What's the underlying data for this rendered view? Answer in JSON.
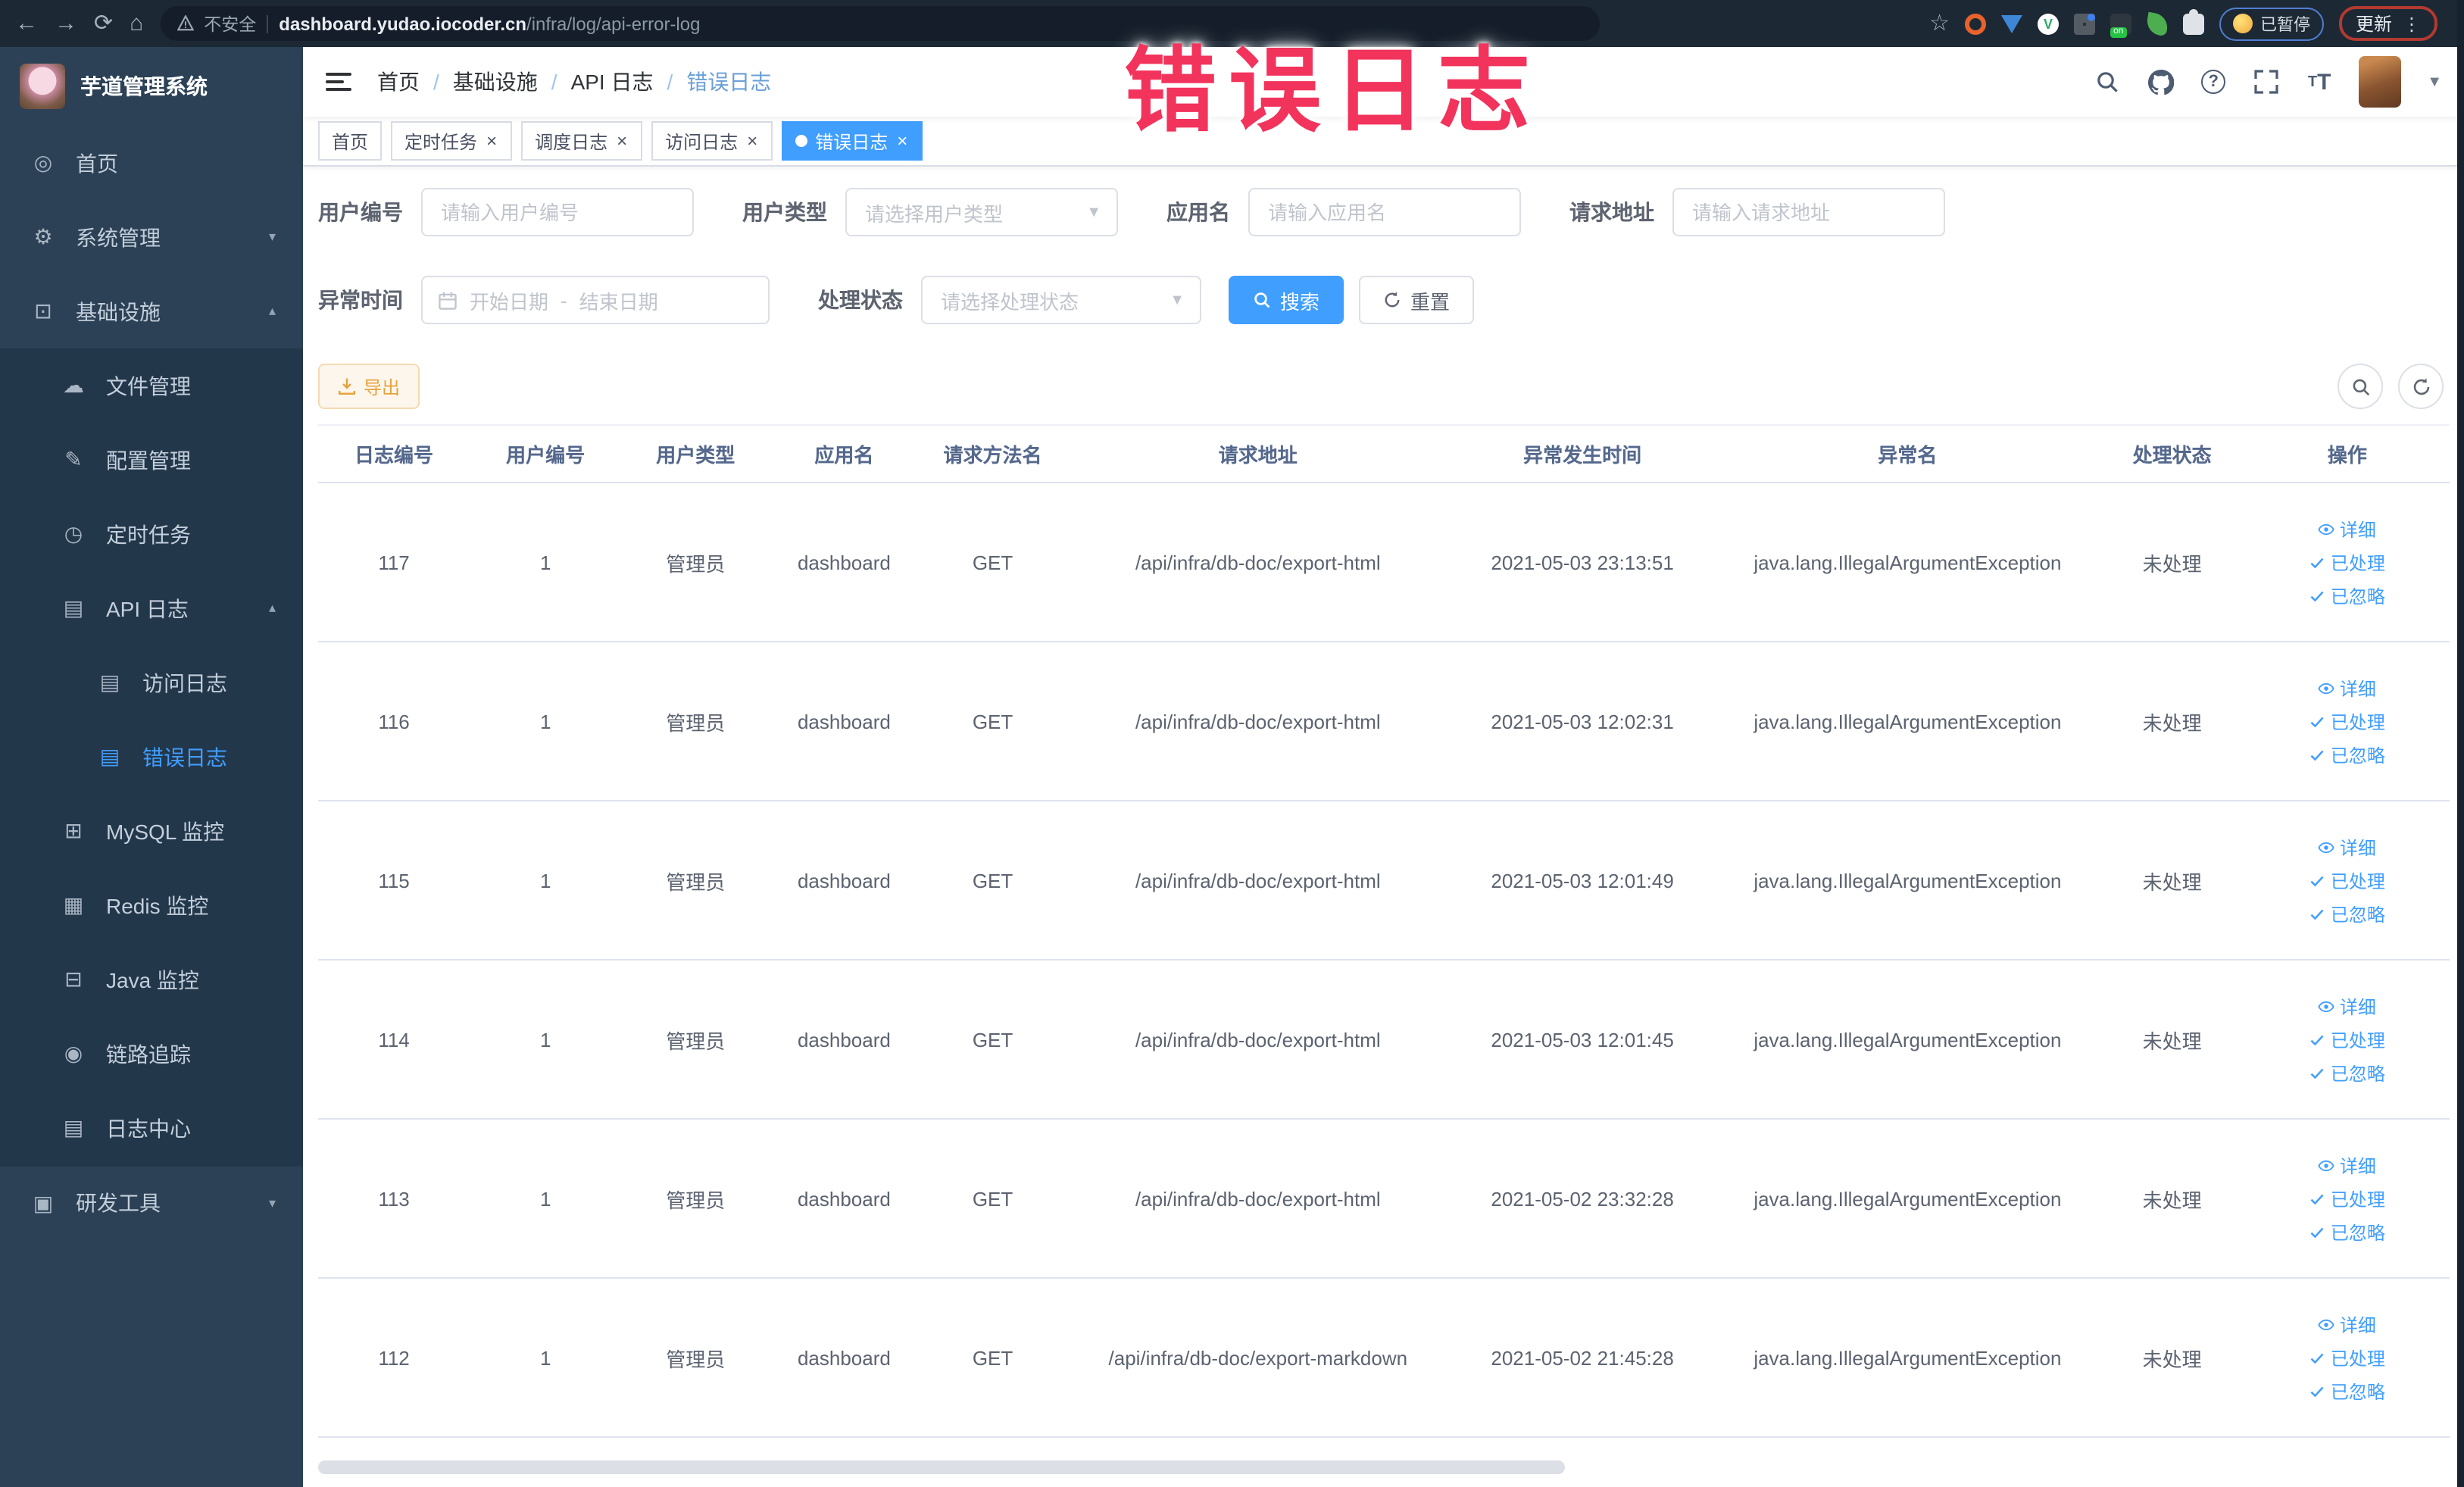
{
  "browser": {
    "security_label": "不安全",
    "url_host": "dashboard.yudao.iocoder.cn",
    "url_path": "/infra/log/api-error-log",
    "paused_label": "已暂停",
    "update_label": "更新"
  },
  "annotation": {
    "text": "错误日志",
    "color": "#f2335c"
  },
  "sidebar": {
    "title": "芋道管理系统",
    "items": [
      {
        "label": "首页",
        "icon": "dashboard",
        "level": 1
      },
      {
        "label": "系统管理",
        "icon": "gear",
        "level": 1,
        "arrow": "down"
      },
      {
        "label": "基础设施",
        "icon": "monitor",
        "level": 1,
        "arrow": "up"
      },
      {
        "label": "文件管理",
        "icon": "cloud",
        "level": 2,
        "dark": true
      },
      {
        "label": "配置管理",
        "icon": "edit",
        "level": 2,
        "dark": true
      },
      {
        "label": "定时任务",
        "icon": "clock",
        "level": 2,
        "dark": true
      },
      {
        "label": "API 日志",
        "icon": "doc",
        "level": 2,
        "dark": true,
        "arrow": "up"
      },
      {
        "label": "访问日志",
        "icon": "doc",
        "level": 3,
        "dark": true
      },
      {
        "label": "错误日志",
        "icon": "doc",
        "level": 3,
        "dark": true,
        "active": true
      },
      {
        "label": "MySQL 监控",
        "icon": "mysql",
        "level": 2,
        "dark": true
      },
      {
        "label": "Redis 监控",
        "icon": "redis",
        "level": 2,
        "dark": true
      },
      {
        "label": "Java 监控",
        "icon": "java",
        "level": 2,
        "dark": true
      },
      {
        "label": "链路追踪",
        "icon": "eye",
        "level": 2,
        "dark": true
      },
      {
        "label": "日志中心",
        "icon": "doc",
        "level": 2,
        "dark": true
      },
      {
        "label": "研发工具",
        "icon": "toolbox",
        "level": 1,
        "arrow": "down",
        "section_top": true
      }
    ]
  },
  "breadcrumb": [
    "首页",
    "基础设施",
    "API 日志",
    "错误日志"
  ],
  "tabs": [
    {
      "label": "首页"
    },
    {
      "label": "定时任务",
      "closable": true
    },
    {
      "label": "调度日志",
      "closable": true
    },
    {
      "label": "访问日志",
      "closable": true
    },
    {
      "label": "错误日志",
      "closable": true,
      "active": true
    }
  ],
  "filters": {
    "user_id_label": "用户编号",
    "user_id_placeholder": "请输入用户编号",
    "user_type_label": "用户类型",
    "user_type_placeholder": "请选择用户类型",
    "app_name_label": "应用名",
    "app_name_placeholder": "请输入应用名",
    "request_url_label": "请求地址",
    "request_url_placeholder": "请输入请求地址",
    "exception_time_label": "异常时间",
    "date_start_placeholder": "开始日期",
    "date_separator": "-",
    "date_end_placeholder": "结束日期",
    "process_status_label": "处理状态",
    "process_status_placeholder": "请选择处理状态",
    "search_button": "搜索",
    "reset_button": "重置"
  },
  "toolbar": {
    "export_button": "导出"
  },
  "table": {
    "columns": [
      "日志编号",
      "用户编号",
      "用户类型",
      "应用名",
      "请求方法名",
      "请求地址",
      "异常发生时间",
      "异常名",
      "处理状态",
      "操作"
    ],
    "row_actions": [
      {
        "icon": "eye",
        "label": "详细"
      },
      {
        "icon": "check",
        "label": "已处理"
      },
      {
        "icon": "check",
        "label": "已忽略"
      }
    ],
    "rows": [
      {
        "id": "117",
        "user_id": "1",
        "user_type": "管理员",
        "app": "dashboard",
        "method": "GET",
        "url": "/api/infra/db-doc/export-html",
        "time": "2021-05-03 23:13:51",
        "exception": "java.lang.IllegalArgumentException",
        "status": "未处理"
      },
      {
        "id": "116",
        "user_id": "1",
        "user_type": "管理员",
        "app": "dashboard",
        "method": "GET",
        "url": "/api/infra/db-doc/export-html",
        "time": "2021-05-03 12:02:31",
        "exception": "java.lang.IllegalArgumentException",
        "status": "未处理"
      },
      {
        "id": "115",
        "user_id": "1",
        "user_type": "管理员",
        "app": "dashboard",
        "method": "GET",
        "url": "/api/infra/db-doc/export-html",
        "time": "2021-05-03 12:01:49",
        "exception": "java.lang.IllegalArgumentException",
        "status": "未处理"
      },
      {
        "id": "114",
        "user_id": "1",
        "user_type": "管理员",
        "app": "dashboard",
        "method": "GET",
        "url": "/api/infra/db-doc/export-html",
        "time": "2021-05-03 12:01:45",
        "exception": "java.lang.IllegalArgumentException",
        "status": "未处理"
      },
      {
        "id": "113",
        "user_id": "1",
        "user_type": "管理员",
        "app": "dashboard",
        "method": "GET",
        "url": "/api/infra/db-doc/export-html",
        "time": "2021-05-02 23:32:28",
        "exception": "java.lang.IllegalArgumentException",
        "status": "未处理"
      },
      {
        "id": "112",
        "user_id": "1",
        "user_type": "管理员",
        "app": "dashboard",
        "method": "GET",
        "url": "/api/infra/db-doc/export-markdown",
        "time": "2021-05-02 21:45:28",
        "exception": "java.lang.IllegalArgumentException",
        "status": "未处理"
      }
    ]
  },
  "colors": {
    "accent": "#409eff",
    "warning": "#e6a23c",
    "sidebar_bg": "#2c4156",
    "annotation": "#f2335c"
  }
}
